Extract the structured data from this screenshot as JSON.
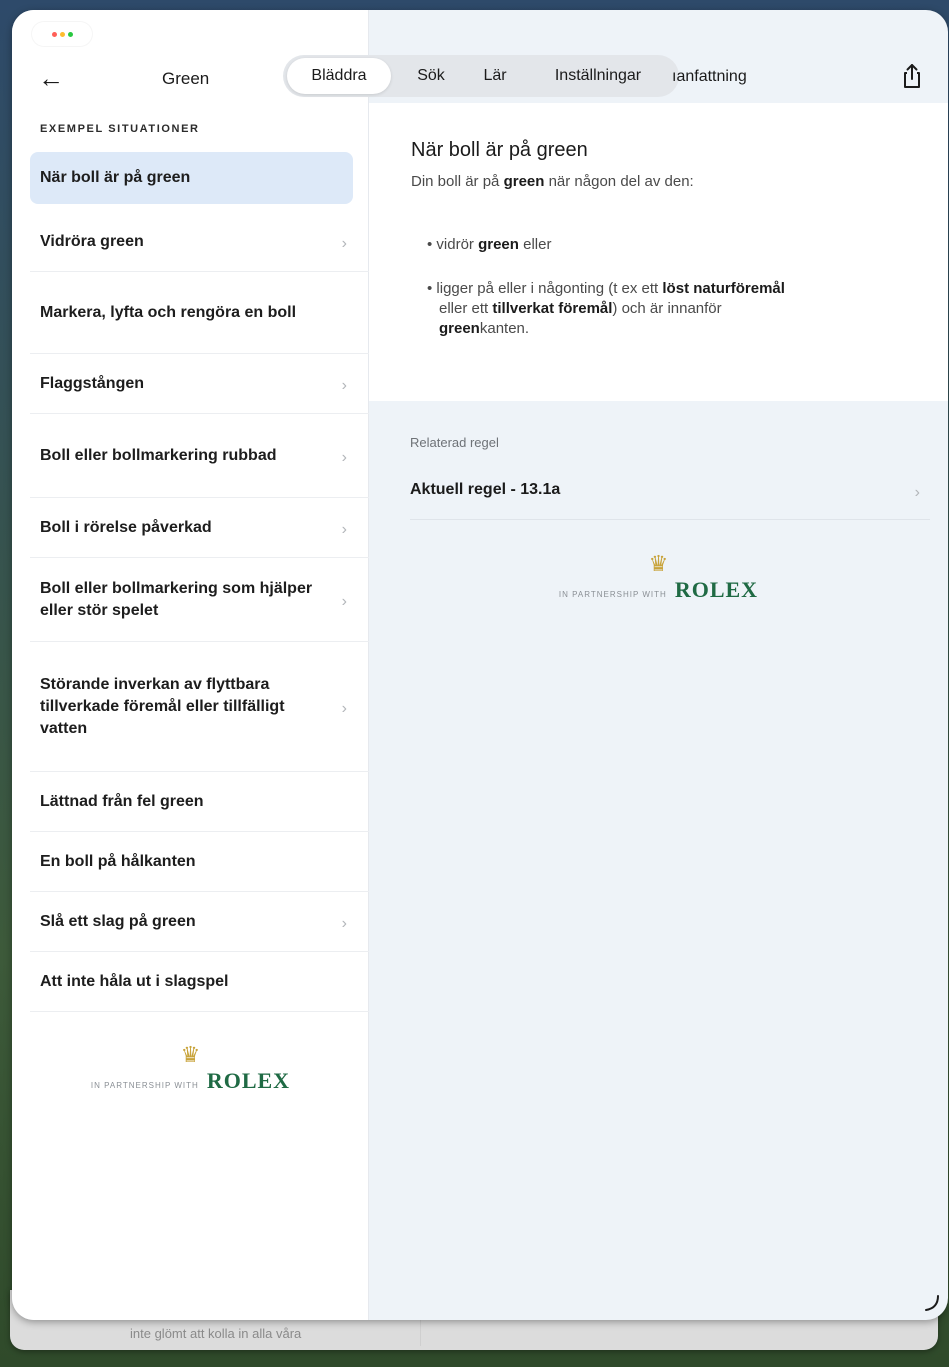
{
  "window": {
    "traffic_colors": [
      "#ff5f57",
      "#febc2e",
      "#28c840"
    ]
  },
  "topbar": {
    "back_icon": "arrow-left-icon",
    "sidebar_title": "Green",
    "tabs": [
      {
        "label": "Bläddra",
        "active": true
      },
      {
        "label": "Sök",
        "active": false
      },
      {
        "label": "Lär",
        "active": false
      },
      {
        "label": "Inställningar",
        "active": false
      }
    ],
    "partial_tab": "ıanfattning",
    "share_icon": "share-icon"
  },
  "sidebar": {
    "section_label": "EXEMPEL SITUATIONER",
    "items": [
      {
        "label": "När boll är på green",
        "chevron": false,
        "selected": true
      },
      {
        "label": "Vidröra green",
        "chevron": true,
        "selected": false
      },
      {
        "label": "Markera, lyfta och rengöra en boll",
        "chevron": false,
        "selected": false
      },
      {
        "label": "Flaggstången",
        "chevron": true,
        "selected": false
      },
      {
        "label": "Boll eller bollmarkering rubbad",
        "chevron": true,
        "selected": false
      },
      {
        "label": "Boll i rörelse påverkad",
        "chevron": true,
        "selected": false
      },
      {
        "label": "Boll eller bollmarkering som hjälper eller stör spelet",
        "chevron": true,
        "selected": false
      },
      {
        "label": "Störande inverkan av flyttbara tillverkade föremål eller tillfälligt vatten",
        "chevron": true,
        "selected": false
      },
      {
        "label": "Lättnad från fel green",
        "chevron": false,
        "selected": false
      },
      {
        "label": "En boll på hålkanten",
        "chevron": false,
        "selected": false
      },
      {
        "label": "Slå ett slag på green",
        "chevron": true,
        "selected": false
      },
      {
        "label": "Att inte håla ut i slagspel",
        "chevron": false,
        "selected": false
      }
    ],
    "sponsor": {
      "partner_text": "IN PARTNERSHIP WITH",
      "brand": "ROLEX"
    }
  },
  "content": {
    "title": "När boll är på green",
    "lead_prefix": "Din boll är på ",
    "lead_bold": "green",
    "lead_suffix": " när någon del av den:",
    "bullet1_prefix": "• vidrör ",
    "bullet1_bold": "green",
    "bullet1_suffix": " eller",
    "bullet2_a": "• ligger på eller i någonting (t ex ett ",
    "bullet2_bold1": "löst naturföremål",
    "bullet2_b": " eller ett ",
    "bullet2_bold2": "tillverkat föremål",
    "bullet2_c": ") och är innanför",
    "bullet2_bold3": "green",
    "bullet2_d": "kanten.",
    "related_label": "Relaterad regel",
    "rule_link": "Aktuell regel - 13.1a",
    "sponsor": {
      "partner_text": "IN PARTNERSHIP WITH",
      "brand": "ROLEX"
    }
  },
  "background_window": {
    "text": "inte glömt att kolla in alla våra"
  }
}
